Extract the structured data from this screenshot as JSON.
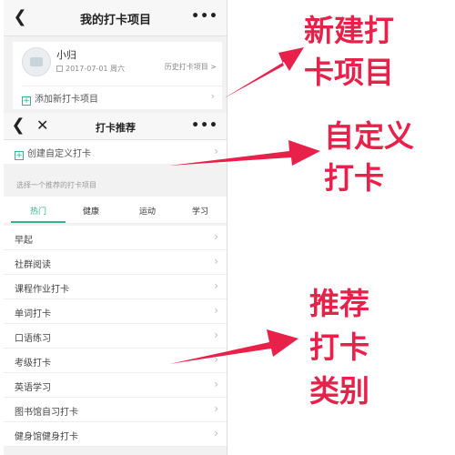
{
  "screen_mine": {
    "title": "我的打卡项目",
    "task": {
      "name": "小归",
      "date": "2017-07-01 周六",
      "history_link": "历史打卡项目 >"
    },
    "add_label": "添加新打卡项目"
  },
  "screen_recommend": {
    "title": "打卡推荐",
    "custom_label": "创建自定义打卡",
    "hint": "选择一个推荐的打卡项目",
    "tabs": [
      "热门",
      "健康",
      "运动",
      "学习"
    ],
    "active_tab": "热门",
    "items": [
      "早起",
      "社群阅读",
      "课程作业打卡",
      "单词打卡",
      "口语练习",
      "考级打卡",
      "英语学习",
      "图书馆自习打卡",
      "健身馆健身打卡"
    ]
  },
  "annotations": {
    "new_project": [
      "新建打",
      "卡项目"
    ],
    "custom_checkin": [
      "自定义",
      "打卡"
    ],
    "recommended_categories": [
      "推荐",
      "打卡",
      "类别"
    ]
  },
  "colors": {
    "accent": "#3bb08f",
    "annotation": "#e8214a"
  },
  "icons": {
    "back": "chevron-left-icon",
    "close": "close-icon",
    "more": "more-dots-icon",
    "add": "plus-box-icon",
    "calendar": "calendar-icon",
    "chevron": "chevron-right-icon"
  }
}
